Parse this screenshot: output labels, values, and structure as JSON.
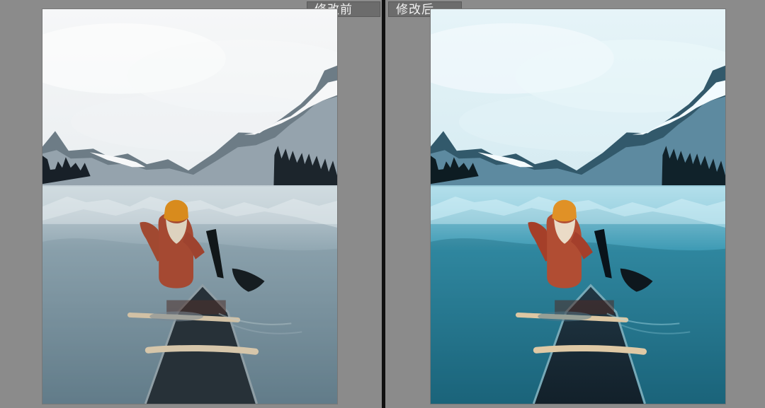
{
  "labels": {
    "before": "修改前",
    "after": "修改后"
  },
  "icons": {
    "before": "photo-icon",
    "after": "photo-icon"
  },
  "colors": {
    "background": "#8b8b8b",
    "divider": "#111111",
    "label_background": "#6c6c6c",
    "label_text": "#f2f2f2",
    "before_sky": "#e9eef1",
    "after_sky": "#dbeef4",
    "before_water": "#7f98a5",
    "after_water": "#2c95b1",
    "jacket": "#b14d33",
    "hat": "#d88b1d"
  }
}
